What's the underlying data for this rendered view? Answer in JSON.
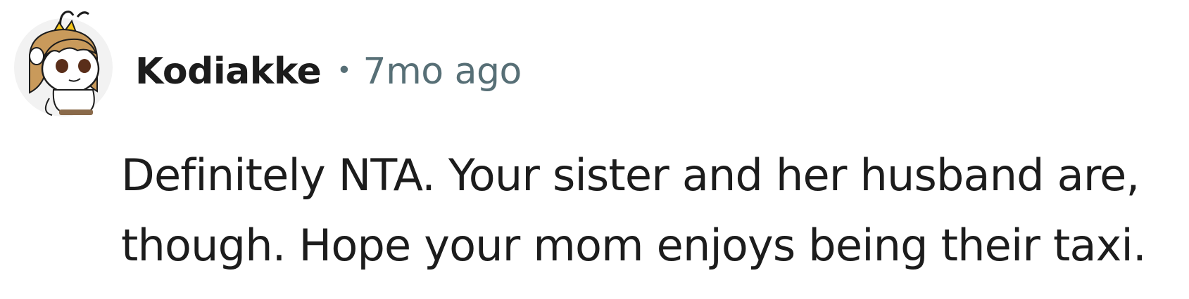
{
  "comment": {
    "author": {
      "username": "Kodiakke",
      "avatar_icon": "snoo-avatar-icon"
    },
    "separator": "•",
    "timestamp": "7mo ago",
    "body_lines": [
      "Definitely NTA. Your sister and her husband are,",
      "though. Hope your mom enjoys being their taxi."
    ]
  },
  "colors": {
    "text_primary": "#1c1c1c",
    "text_secondary": "#576f76",
    "background": "#ffffff"
  }
}
